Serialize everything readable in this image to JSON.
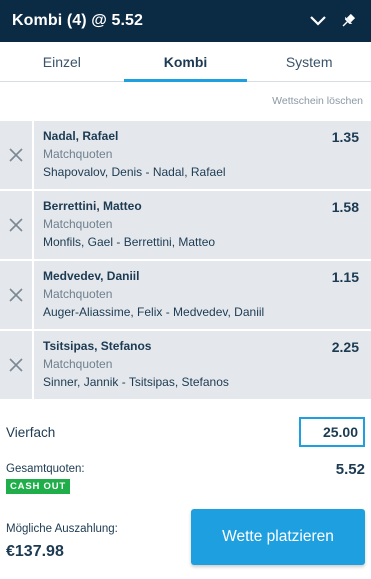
{
  "header": {
    "title": "Kombi (4) @ 5.52",
    "icons": [
      "chevron-down-icon",
      "pin-icon"
    ]
  },
  "tabs": [
    {
      "label": "Einzel",
      "active": false
    },
    {
      "label": "Kombi",
      "active": true
    },
    {
      "label": "System",
      "active": false
    }
  ],
  "clear_link": "Wettschein löschen",
  "bets": [
    {
      "selection": "Nadal, Rafael",
      "market": "Matchquoten",
      "event": "Shapovalov, Denis - Nadal, Rafael",
      "odds": "1.35"
    },
    {
      "selection": "Berrettini, Matteo",
      "market": "Matchquoten",
      "event": "Monfils, Gael - Berrettini, Matteo",
      "odds": "1.58"
    },
    {
      "selection": "Medvedev, Daniil",
      "market": "Matchquoten",
      "event": "Auger-Aliassime, Felix - Medvedev, Daniil",
      "odds": "1.15"
    },
    {
      "selection": "Tsitsipas, Stefanos",
      "market": "Matchquoten",
      "event": "Sinner, Jannik - Tsitsipas, Stefanos",
      "odds": "2.25"
    }
  ],
  "stake": {
    "label": "Vierfach",
    "value": "25.00"
  },
  "totals": {
    "label": "Gesamtquoten:",
    "value": "5.52",
    "cashout_badge": "CASH OUT"
  },
  "payout": {
    "label": "Mögliche Auszahlung:",
    "amount": "€137.98"
  },
  "place_button": "Wette platzieren",
  "colors": {
    "header_bg": "#0b2a44",
    "accent": "#1ea0e0",
    "cashout": "#1fae4a",
    "bet_bg": "#e4e8ec"
  }
}
